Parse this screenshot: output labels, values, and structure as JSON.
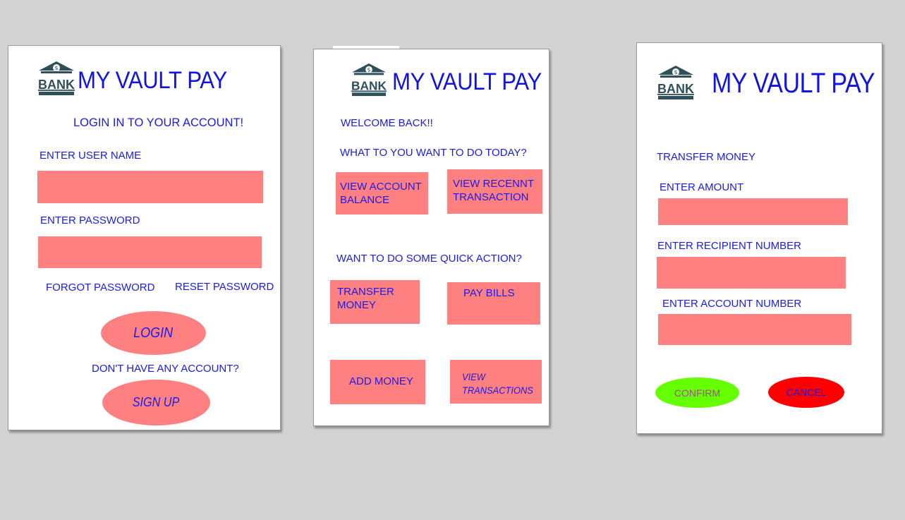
{
  "logo": {
    "icon": "bank-icon",
    "text": "BANK",
    "symbol": "$"
  },
  "brand": "MY VAULT PAY",
  "colors": {
    "accent": "#1a1aeb",
    "field": "#ff8080",
    "confirm": "#66ff00",
    "cancel": "#ff0000",
    "background": "#d3d3d3"
  },
  "login": {
    "heading": "LOGIN IN TO YOUR ACCOUNT!",
    "username_label": "ENTER USER NAME",
    "username_value": "",
    "password_label": "ENTER PASSWORD",
    "password_value": "",
    "forgot": "FORGOT PASSWORD",
    "reset": "RESET PASSWORD",
    "login_button": "LOGIN",
    "no_account": "DON'T HAVE ANY ACCOUNT?",
    "signup_button": "SIGN UP"
  },
  "dashboard": {
    "welcome": "WELCOME BACK!!",
    "question": "WHAT TO YOU WANT TO DO TODAY?",
    "view_balance": "VIEW ACCOUNT BALANCE",
    "view_recent": "VIEW RECENNT TRANSACTION",
    "quick_action": "WANT TO DO SOME QUICK ACTION?",
    "transfer": "TRANSFER MONEY",
    "pay_bills": "PAY BILLS",
    "add_money": "ADD MONEY",
    "view_transactions": "VIEW TRANSACTIONS"
  },
  "transfer": {
    "heading": "TRANSFER MONEY",
    "amount_label": "ENTER AMOUNT",
    "amount_value": "",
    "recipient_label": "ENTER RECIPIENT NUMBER",
    "recipient_value": "",
    "account_label": "ENTER ACCOUNT NUMBER",
    "account_value": "",
    "confirm_button": "CONFIRM",
    "cancel_button": "CANCEL"
  }
}
